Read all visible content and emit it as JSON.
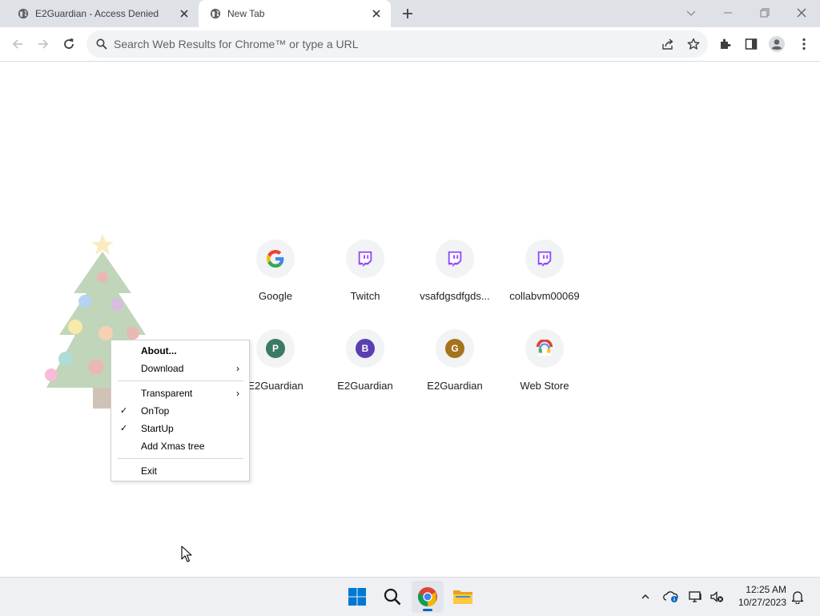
{
  "browser": {
    "tabs": [
      {
        "title": "E2Guardian - Access Denied",
        "active": false
      },
      {
        "title": "New Tab",
        "active": true
      }
    ],
    "omnibox": {
      "placeholder": "Search Web Results for Chrome™ or type a URL"
    }
  },
  "shortcuts": [
    {
      "label": "Google",
      "icon": "google-g-icon"
    },
    {
      "label": "Twitch",
      "icon": "twitch-icon"
    },
    {
      "label": "vsafdgsdfgds...",
      "icon": "twitch-icon"
    },
    {
      "label": "collabvm00069",
      "icon": "twitch-icon"
    },
    {
      "label": "E2Guardian",
      "icon": "letter-icon",
      "letter": "P",
      "color": "#3d7a63"
    },
    {
      "label": "E2Guardian",
      "icon": "letter-icon",
      "letter": "B",
      "color": "#5b3fb0"
    },
    {
      "label": "E2Guardian",
      "icon": "letter-icon",
      "letter": "G",
      "color": "#a5731c"
    },
    {
      "label": "Web Store",
      "icon": "chrome-web-store-icon"
    }
  ],
  "context_menu": {
    "items": [
      {
        "label": "About...",
        "bold": true,
        "checked": false,
        "submenu": false
      },
      {
        "label": "Download",
        "checked": false,
        "submenu": true
      },
      {
        "label": "Transparent",
        "checked": false,
        "submenu": true
      },
      {
        "label": "OnTop",
        "checked": true,
        "submenu": false
      },
      {
        "label": "StartUp",
        "checked": true,
        "submenu": false
      },
      {
        "label": "Add Xmas tree",
        "checked": false,
        "submenu": false
      },
      {
        "label": "Exit",
        "checked": false,
        "submenu": false
      }
    ],
    "check_glyph": "✓",
    "arrow_glyph": "›"
  },
  "taskbar": {
    "clock_time": "12:25 AM",
    "clock_date": "10/27/2023"
  },
  "colors": {
    "tabstrip": "#dee1e6",
    "twitch": "#9146ff",
    "windows_blue": "#0067c0"
  }
}
